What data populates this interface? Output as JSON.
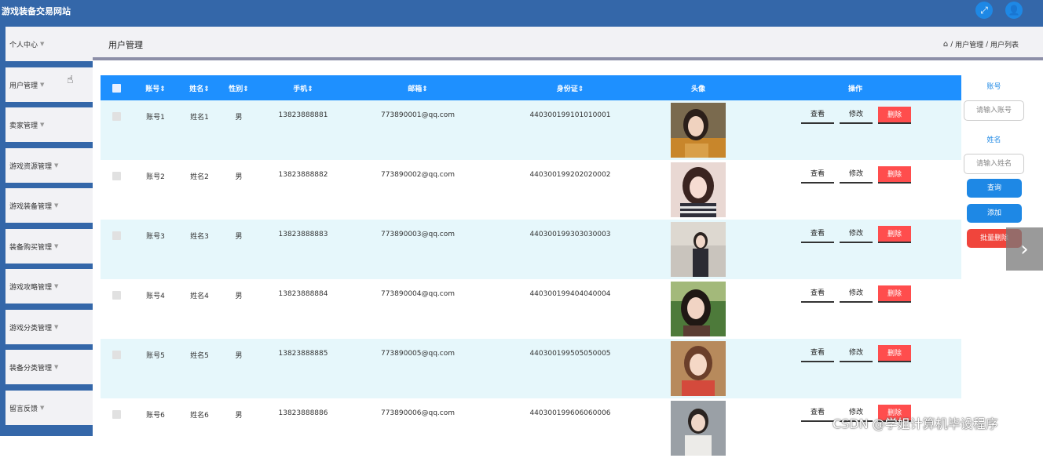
{
  "app": {
    "title": "游戏装备交易网站"
  },
  "topbar": {
    "fullscreen_icon": "fullscreen-icon",
    "user_icon": "user-icon"
  },
  "sidebar": {
    "items": [
      {
        "label": "个人中心"
      },
      {
        "label": "用户管理"
      },
      {
        "label": "卖家管理"
      },
      {
        "label": "游戏资源管理"
      },
      {
        "label": "游戏装备管理"
      },
      {
        "label": "装备购买管理"
      },
      {
        "label": "游戏攻略管理"
      },
      {
        "label": "游戏分类管理"
      },
      {
        "label": "装备分类管理"
      },
      {
        "label": "留言反馈"
      }
    ]
  },
  "header": {
    "page_title": "用户管理",
    "breadcrumb": {
      "home_icon": "home-icon",
      "level1": "用户管理",
      "sep": "/",
      "level2": "用户列表"
    }
  },
  "table": {
    "headers": [
      "账号",
      "姓名",
      "性别",
      "手机",
      "邮箱",
      "身份证",
      "头像",
      "操作"
    ],
    "sort_marker": "⇕",
    "rows": [
      {
        "account": "账号1",
        "name": "姓名1",
        "gender": "男",
        "phone": "13823888881",
        "email": "773890001@qq.com",
        "idcard": "440300199101010001"
      },
      {
        "account": "账号2",
        "name": "姓名2",
        "gender": "男",
        "phone": "13823888882",
        "email": "773890002@qq.com",
        "idcard": "440300199202020002"
      },
      {
        "account": "账号3",
        "name": "姓名3",
        "gender": "男",
        "phone": "13823888883",
        "email": "773890003@qq.com",
        "idcard": "440300199303030003"
      },
      {
        "account": "账号4",
        "name": "姓名4",
        "gender": "男",
        "phone": "13823888884",
        "email": "773890004@qq.com",
        "idcard": "440300199404040004"
      },
      {
        "account": "账号5",
        "name": "姓名5",
        "gender": "男",
        "phone": "13823888885",
        "email": "773890005@qq.com",
        "idcard": "440300199505050005"
      },
      {
        "account": "账号6",
        "name": "姓名6",
        "gender": "男",
        "phone": "13823888886",
        "email": "773890006@qq.com",
        "idcard": "440300199606060006"
      }
    ],
    "actions": {
      "view": "查看",
      "edit": "修改",
      "delete": "删除"
    }
  },
  "search_panel": {
    "account_label": "账号",
    "account_placeholder": "请输入账号",
    "name_label": "姓名",
    "name_placeholder": "请输入姓名",
    "query_button": "查询",
    "add_button": "添加",
    "batch_delete_button": "批量删除"
  },
  "colors": {
    "topbar": "#3467a9",
    "table_header": "#1e90ff",
    "odd_row": "#e6f7fb",
    "delete_button": "#ff4d4d",
    "primary_button": "#1e88e5"
  },
  "watermark": "CSDN @学姐计算机毕设程序"
}
